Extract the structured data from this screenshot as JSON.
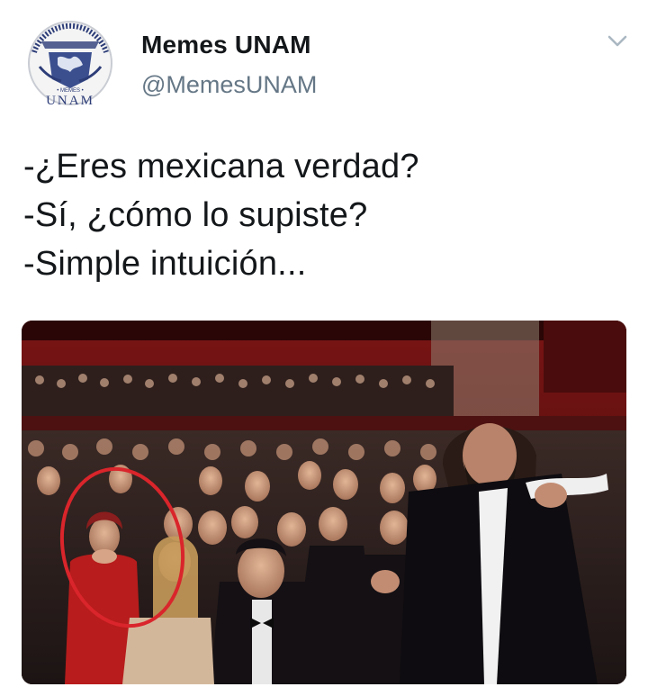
{
  "account": {
    "display_name": "Memes UNAM",
    "handle": "@MemesUNAM",
    "avatar_text": "UNAM",
    "avatar_icon": "unam-seal-icon"
  },
  "menu": {
    "icon": "chevron-down-icon"
  },
  "tweet": {
    "lines": [
      "-¿Eres mexicana verdad?",
      "-Sí, ¿cómo lo supiste?",
      "-Simple intuición..."
    ]
  },
  "media": {
    "type": "photo",
    "highlight_color": "#d9252b"
  }
}
